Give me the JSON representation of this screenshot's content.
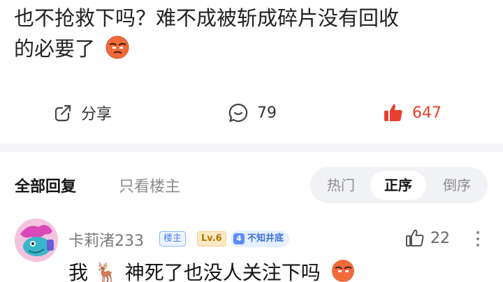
{
  "post": {
    "text_line1": "也不抢救下吗？难不成被斩成碎片没有回收",
    "text_line2": "的必要了",
    "emoji": "basketball-emoji"
  },
  "actions": {
    "share_label": "分享",
    "comment_count": "79",
    "like_count": "647",
    "like_color": "#e8402f"
  },
  "filters": {
    "all_replies": "全部回复",
    "only_op": "只看楼主",
    "sort_options": [
      "热门",
      "正序",
      "倒序"
    ],
    "selected_sort": "正序"
  },
  "reply": {
    "username": "卡莉渚233",
    "host_badge": "楼主",
    "level": "Lv.6",
    "title_level": "4",
    "title_badge": "不知井底",
    "like_count": "22",
    "text_part1": "我",
    "text_part2": "神死了也没人关注下吗",
    "deer_emoji": "🦌"
  }
}
